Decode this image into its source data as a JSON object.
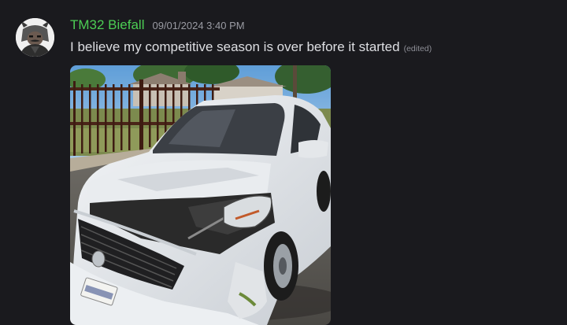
{
  "message": {
    "author": {
      "name": "TM32 Biefall",
      "name_color": "#4ccd54",
      "avatar_icon": "horned-character-avatar"
    },
    "timestamp": "09/01/2024 3:40 PM",
    "text": "I believe my competitive season is over before it started",
    "edited_label": "(edited)",
    "attachment": {
      "type": "image",
      "subject": "white sedan with crashed front end parked on street beside iron fence"
    }
  },
  "colors": {
    "background": "#1a1a1e",
    "message_text": "#dedfe3",
    "timestamp": "#9a9ba3",
    "edited": "#8d8e96"
  }
}
